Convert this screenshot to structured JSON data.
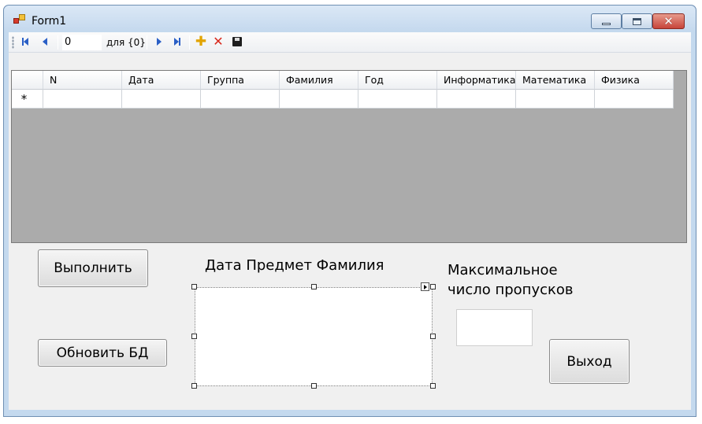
{
  "window": {
    "title": "Form1"
  },
  "toolbar": {
    "position_value": "0",
    "count_label": "для {0}"
  },
  "grid": {
    "new_row_marker": "*",
    "columns": [
      "N",
      "Дата",
      "Группа",
      "Фамилия",
      "Год",
      "Информатика",
      "Математика",
      "Физика"
    ]
  },
  "buttons": {
    "execute": "Выполнить",
    "update_db": "Обновить БД",
    "exit": "Выход"
  },
  "labels": {
    "list_header": "Дата  Предмет Фамилия",
    "max_absences_line1": "Максимальное",
    "max_absences_line2": "число пропусков"
  },
  "inputs": {
    "max_absences_value": ""
  },
  "icons": {
    "app": "form-app-icon",
    "first": "move-first-icon",
    "prev": "move-previous-icon",
    "next": "move-next-icon",
    "last": "move-last-icon",
    "add": "add-new-icon",
    "delete": "delete-icon",
    "save": "save-icon"
  }
}
